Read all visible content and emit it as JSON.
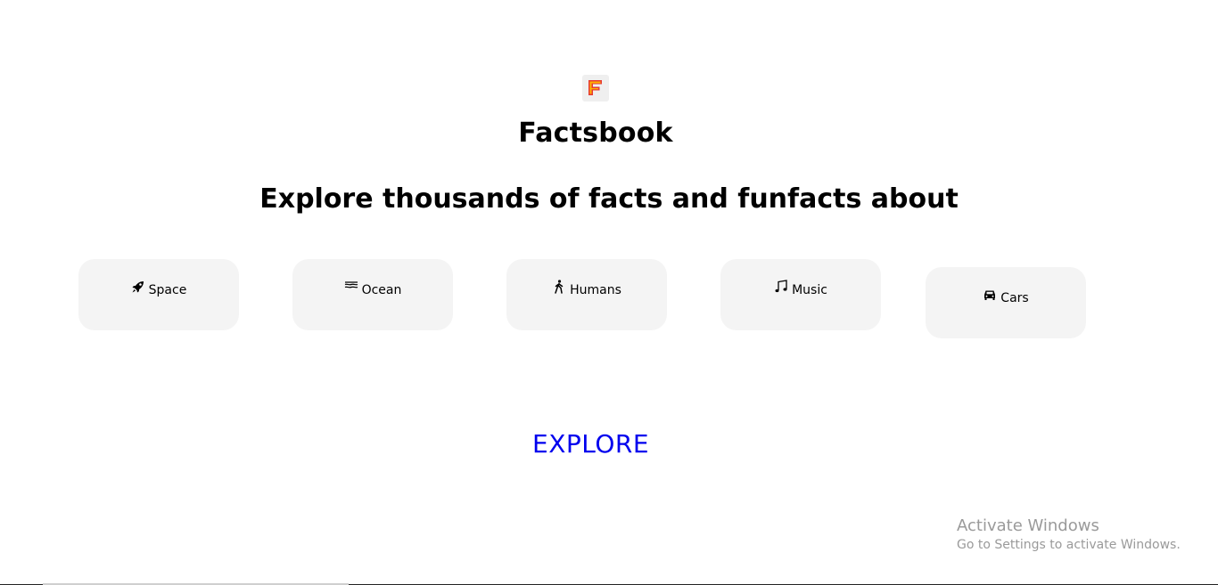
{
  "brand": {
    "logo_icon": "factsbook-logo-icon",
    "name": "Factsbook"
  },
  "headline": "Explore thousands of facts and funfacts about",
  "categories": [
    {
      "label": "Space",
      "icon": "rocket-icon"
    },
    {
      "label": "Ocean",
      "icon": "waves-icon"
    },
    {
      "label": "Humans",
      "icon": "person-walking-icon"
    },
    {
      "label": "Music",
      "icon": "music-note-icon"
    },
    {
      "label": "Cars",
      "icon": "car-icon"
    }
  ],
  "cta": {
    "label": "EXPLORE"
  },
  "watermark": {
    "title": "Activate Windows",
    "subtitle": "Go to Settings to activate Windows."
  },
  "colors": {
    "link": "#0000ee",
    "card_bg": "#f4f4f4",
    "logo_orange": "#f57c2b",
    "logo_red": "#e53935"
  }
}
